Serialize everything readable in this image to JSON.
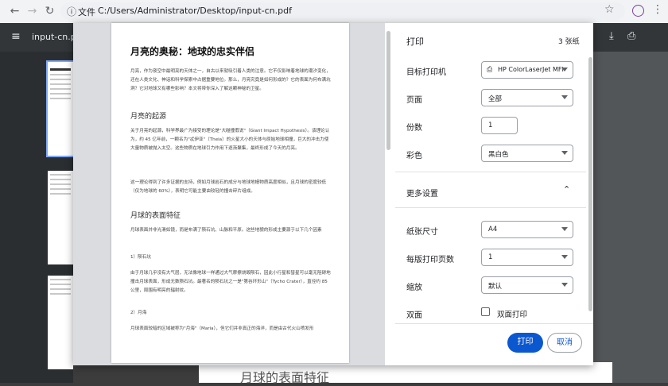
{
  "browser": {
    "tab_info_label": "文件",
    "url": "C:/Users/Administrator/Desktop/input-cn.pdf",
    "icons": [
      "back-arrow-icon",
      "forward-arrow-icon",
      "reload-icon",
      "info-icon",
      "star-icon",
      "profile-icon",
      "kebab-menu-icon"
    ]
  },
  "viewer": {
    "filename": "input-cn.pdf",
    "background_heading": "月球的表面特征"
  },
  "preview": {
    "title": "月亮的奥秘：地球的忠实伴侣",
    "intro": "月亮，作为夜空中最明亮的天体之一，自古以来就吸引着人类的注意。它不仅影响着地球的潮汐变化，还在人类文化、神话和科学探索中占据重要地位。那么，月亮究竟是如何形成的？它的表面为何布满坑洞？它对地球又有哪些影响？本文将带你深入了解这颗神秘的卫星。",
    "section1": "月亮的起源",
    "s1p1": "关于月亮的起源，科学界最广为接受的理论是\"大碰撞假说\"（Giant Impact Hypothesis）。该理论认为，约 45 亿年前，一颗名为\"忒伊亚\"（Theia）的火星大小的天体与原始地球相撞，巨大的冲击力使大量物质被抛入太空。这些物质在地球引力作用下逐渐聚集，最终形成了今天的月亮。",
    "s1p2": "这一理论得到了许多证据的支持，例如月球岩石的成分与地球地幔物质高度相似，且月球的密度较低（仅为地球的 60%），表明它可能主要由较轻的撞击碎片组成。",
    "section2": "月球的表面特征",
    "s2p1": "月球表面并非光滑如镜，而是布满了陨石坑、山脉和平原。这些地貌的形成主要源于以下几个因素",
    "sub1": "1）陨石坑",
    "sub1p": "由于月球几乎没有大气层，无法像地球一样通过大气摩擦烧毁陨石，因此小行星和彗星可以毫无阻碍地撞击月球表面，形成无数陨石坑。最著名的陨石坑之一是\"第谷环形山\"（Tycho Crater），直径约 85 公里，周围有明亮的辐射纹。",
    "sub2": "2）月海",
    "sub2p": "月球表面较暗的区域被称为\"月海\"（Maria），但它们并非真正的海洋，而是由古代火山喷发形"
  },
  "print": {
    "title": "打印",
    "sheets": "3 张纸",
    "destination_label": "目标打印机",
    "destination_value": "HP ColorLaserJet MFI",
    "pages_label": "页面",
    "pages_value": "全部",
    "copies_label": "份数",
    "copies_value": "1",
    "color_label": "彩色",
    "color_value": "黑白色",
    "more_settings_label": "更多设置",
    "paper_size_label": "纸张尺寸",
    "paper_size_value": "A4",
    "pages_per_sheet_label": "每版打印页数",
    "pages_per_sheet_value": "1",
    "scale_label": "缩放",
    "scale_value": "默认",
    "duplex_label": "双面",
    "duplex_checkbox_label": "双面打印",
    "duplex_checked": false,
    "print_button": "打印",
    "cancel_button": "取消",
    "accent_color": "#0b57d0"
  }
}
